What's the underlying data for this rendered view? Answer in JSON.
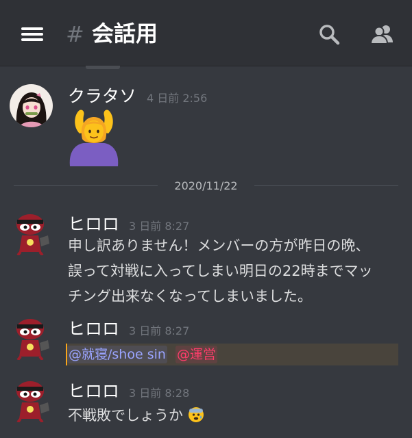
{
  "header": {
    "hash": "#",
    "channel_name": "会話用",
    "icons": [
      "menu-icon",
      "search-icon",
      "members-icon"
    ]
  },
  "messages": [
    {
      "author": "クラタソ",
      "timestamp": "4 日前 2:56",
      "content": "emoji: woman gesturing OK",
      "avatar": "anime girl avatar"
    },
    {
      "author": "ヒロロ",
      "timestamp": "3 日前 8:27",
      "lines": [
        "申し訳ありません！メンバーの方が昨日の晩、",
        "誤って対戦に入ってしまい明日の22時までマッ",
        "チング出来なくなってしまいました。"
      ]
    },
    {
      "author": "ヒロロ",
      "timestamp": "3 日前 8:27",
      "mention_user": "@就寝/shoe sin",
      "mention_role": "@運営"
    },
    {
      "author": "ヒロロ",
      "timestamp": "3 日前 8:28",
      "content": "不戦敗でしょうか"
    }
  ],
  "date_divider": "2020/11/22",
  "colors": {
    "background": "#36393f",
    "header": "#2f3136",
    "mention_highlight": "#49443c",
    "mention_border": "#faa61a",
    "user_mention": "#9aa4ff",
    "role_mention": "#ff3d6b"
  }
}
